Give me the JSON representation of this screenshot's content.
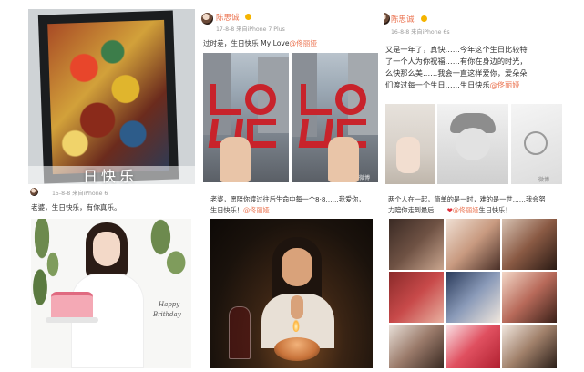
{
  "panel_painting": {
    "caption": "日快乐"
  },
  "post_top_mid": {
    "username": "陈思诚",
    "meta": "17-8-8 来自iPhone 7 Plus",
    "text_prefix": "过时差，生日快乐 My Love",
    "mention": "@佟丽娅",
    "sign_text": "LOVE",
    "watermark": "微博"
  },
  "post_top_right": {
    "username": "陈思诚",
    "meta": "16-8-8 来自iPhone 6s",
    "lines": [
      "又是一年了，真快……今年这个生日比较特",
      "了一个人为你祝福……有你在身边的时光，",
      "么快那么美……我会一直这样爱你，爱朵朵",
      "们渡过每一个生日……生日快乐"
    ],
    "mention": "@佟丽娅",
    "watermark": "微博"
  },
  "post_bottom_left": {
    "meta": "15-8-8 来自iPhone 6",
    "text": "老婆，生日快乐，有你真乐。",
    "card_line1": "Happy",
    "card_line2": "Brithday"
  },
  "post_bottom_mid": {
    "text_line1": "老婆，愿陪你渡过往后生命中每一个8·8……我爱你，",
    "text_line2_prefix": "生日快乐！",
    "mention": "@佟丽娅"
  },
  "post_bottom_right": {
    "text_line1": "两个人在一起，简单的是一时，难的是一世……我会努",
    "text_line2_prefix": "力陪你走到最后……",
    "heart": "❤",
    "mention": "@佟丽娅",
    "text_line2_suffix": "生日快乐！"
  },
  "colors": {
    "username": "#eb7350",
    "mention": "#eb7350",
    "sign_red": "#c8232b"
  }
}
